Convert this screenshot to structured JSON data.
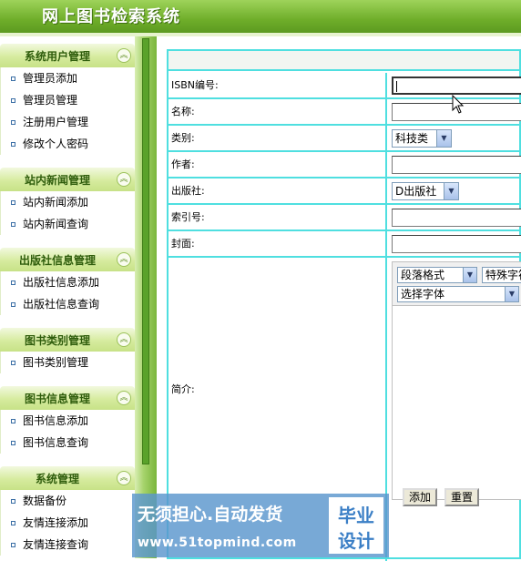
{
  "app": {
    "title": "网上图书检索系统"
  },
  "sidebar": {
    "sections": [
      {
        "title": "系统用户管理",
        "items": [
          "管理员添加",
          "管理员管理",
          "注册用户管理",
          "修改个人密码"
        ]
      },
      {
        "title": "站内新闻管理",
        "items": [
          "站内新闻添加",
          "站内新闻查询"
        ]
      },
      {
        "title": "出版社信息管理",
        "items": [
          "出版社信息添加",
          "出版社信息查询"
        ]
      },
      {
        "title": "图书类别管理",
        "items": [
          "图书类别管理"
        ]
      },
      {
        "title": "图书信息管理",
        "items": [
          "图书信息添加",
          "图书信息查询"
        ]
      },
      {
        "title": "系统管理",
        "items": [
          "数据备份",
          "友情连接添加",
          "友情连接查询"
        ]
      }
    ],
    "toggle_icon": "collapse-up-icon"
  },
  "form": {
    "isbn_label": "ISBN编号:",
    "isbn_value": "",
    "name_label": "名称:",
    "name_value": "",
    "category_label": "类别:",
    "category_value": "科技类",
    "author_label": "作者:",
    "author_value": "",
    "publisher_label": "出版社:",
    "publisher_value": "D出版社",
    "index_label": "索引号:",
    "index_value": "",
    "cover_label": "封面:",
    "cover_value": "",
    "intro_label": "简介:",
    "editor": {
      "paragraph_select": "段落格式",
      "special_select": "特殊字符",
      "font_select": "选择字体"
    },
    "add_button": "添加",
    "reset_button": "重置"
  },
  "watermark": {
    "line1": "无须担心.自动发货",
    "line2": "www.51topmind.com",
    "logo_top": "毕业",
    "logo_bottom": "设计"
  },
  "colors": {
    "header_green": "#6fae2a",
    "table_border": "#4fdfe0",
    "watermark_blue": "#5a96cd"
  }
}
